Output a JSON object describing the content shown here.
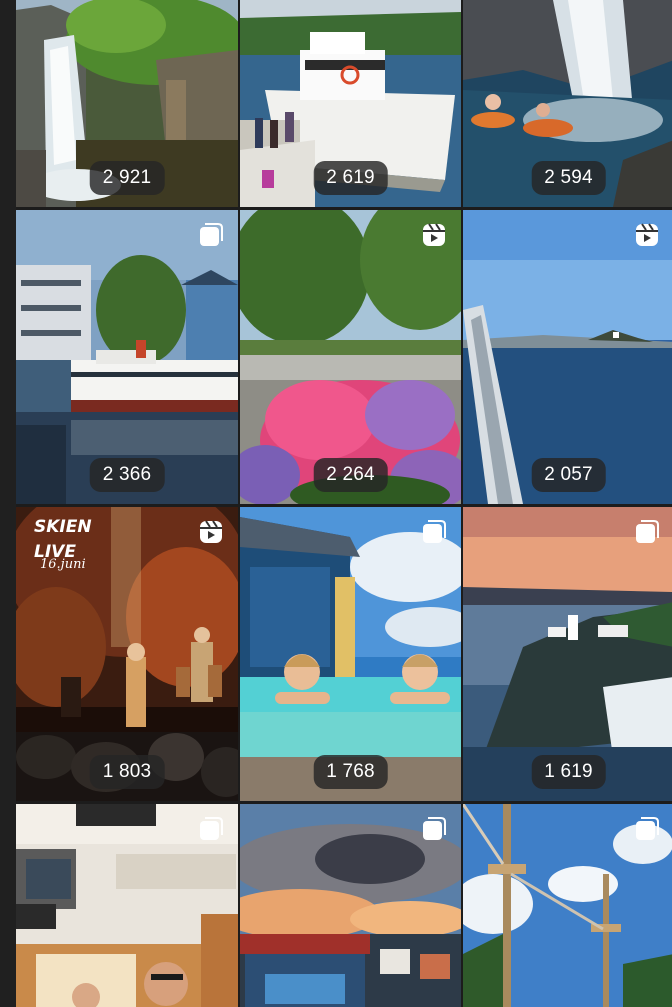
{
  "colors": {
    "background": "#1c1c1c",
    "badge_background": "#262626",
    "text": "#ffffff"
  },
  "posts": [
    {
      "views": "2 921",
      "badge": "none",
      "scene": "waterfall"
    },
    {
      "views": "2 619",
      "badge": "none",
      "scene": "ferry"
    },
    {
      "views": "2 594",
      "badge": "none",
      "scene": "swimmers"
    },
    {
      "views": "2 366",
      "badge": "carousel-icon",
      "scene": "harbour-ship"
    },
    {
      "views": "2 264",
      "badge": "reel-icon",
      "scene": "hydrangeas"
    },
    {
      "views": "2 057",
      "badge": "reel-icon",
      "scene": "sea-view"
    },
    {
      "views": "1 803",
      "badge": "reel-icon",
      "scene": "concert",
      "poster_title_1": "SKIEN",
      "poster_title_2": "LIVE",
      "poster_date": "16.juni"
    },
    {
      "views": "1 768",
      "badge": "carousel-icon",
      "scene": "pool-kids"
    },
    {
      "views": "1 619",
      "badge": "carousel-icon",
      "scene": "lighthouse"
    },
    {
      "views": "",
      "badge": "carousel-icon",
      "scene": "boat-cabin"
    },
    {
      "views": "",
      "badge": "carousel-icon",
      "scene": "sunset-town"
    },
    {
      "views": "",
      "badge": "carousel-icon",
      "scene": "ropes-course"
    }
  ]
}
